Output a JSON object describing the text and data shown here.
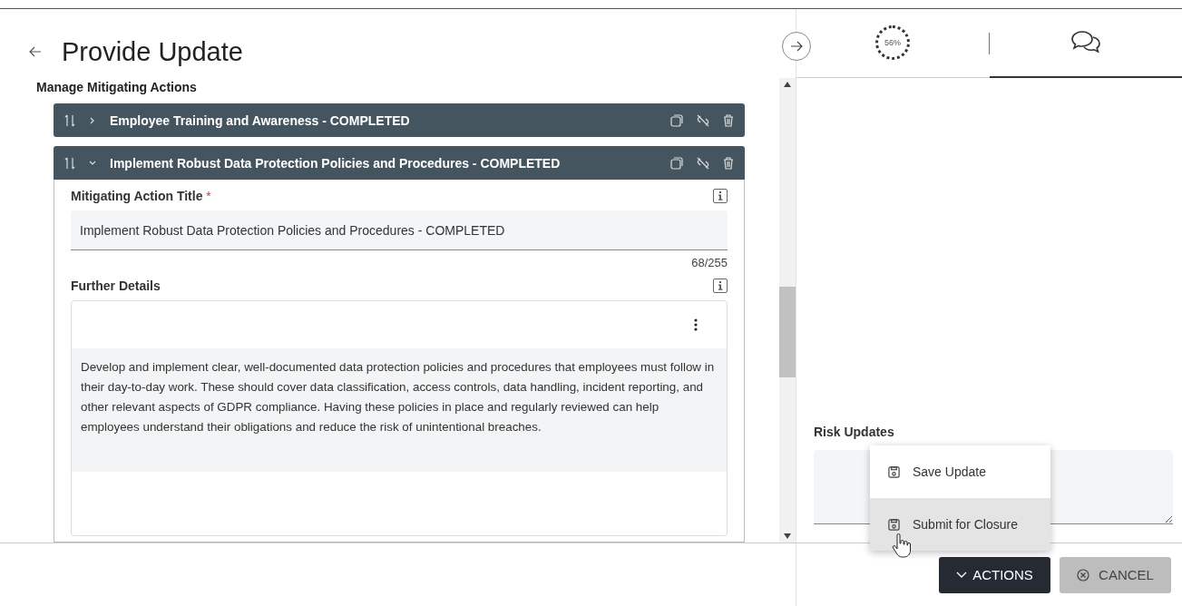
{
  "page": {
    "title": "Provide Update"
  },
  "mitigating_actions": {
    "label": "Manage Mitigating Actions",
    "items": [
      {
        "title": "Employee Training and Awareness - COMPLETED",
        "expanded": false
      },
      {
        "title": "Implement Robust Data Protection Policies and Procedures - COMPLETED",
        "expanded": true,
        "title_field": {
          "label": "Mitigating Action Title",
          "required_mark": "*",
          "value": "Implement Robust Data Protection Policies and Procedures - COMPLETED",
          "counter": "68/255"
        },
        "details_field": {
          "label": "Further Details",
          "value": "Develop and implement clear, well-documented data protection policies and procedures that employees must follow in their day-to-day work. These should cover data classification, access controls, data handling, incident reporting, and other relevant aspects of GDPR compliance. Having these policies in place and regularly reviewed can help employees understand their obligations and reduce the risk of unintentional breaches."
        }
      }
    ]
  },
  "side_panel": {
    "progress": "56%",
    "tabs": [
      {
        "kind": "progress",
        "selected": false
      },
      {
        "kind": "comments",
        "selected": true
      }
    ],
    "risk_updates": {
      "label": "Risk Updates"
    }
  },
  "actions_menu": {
    "items": [
      {
        "label": "Save Update",
        "selected": false
      },
      {
        "label": "Submit for Closure",
        "selected": true
      }
    ]
  },
  "footer": {
    "actions_button": "ACTIONS",
    "cancel_button": "CANCEL"
  }
}
